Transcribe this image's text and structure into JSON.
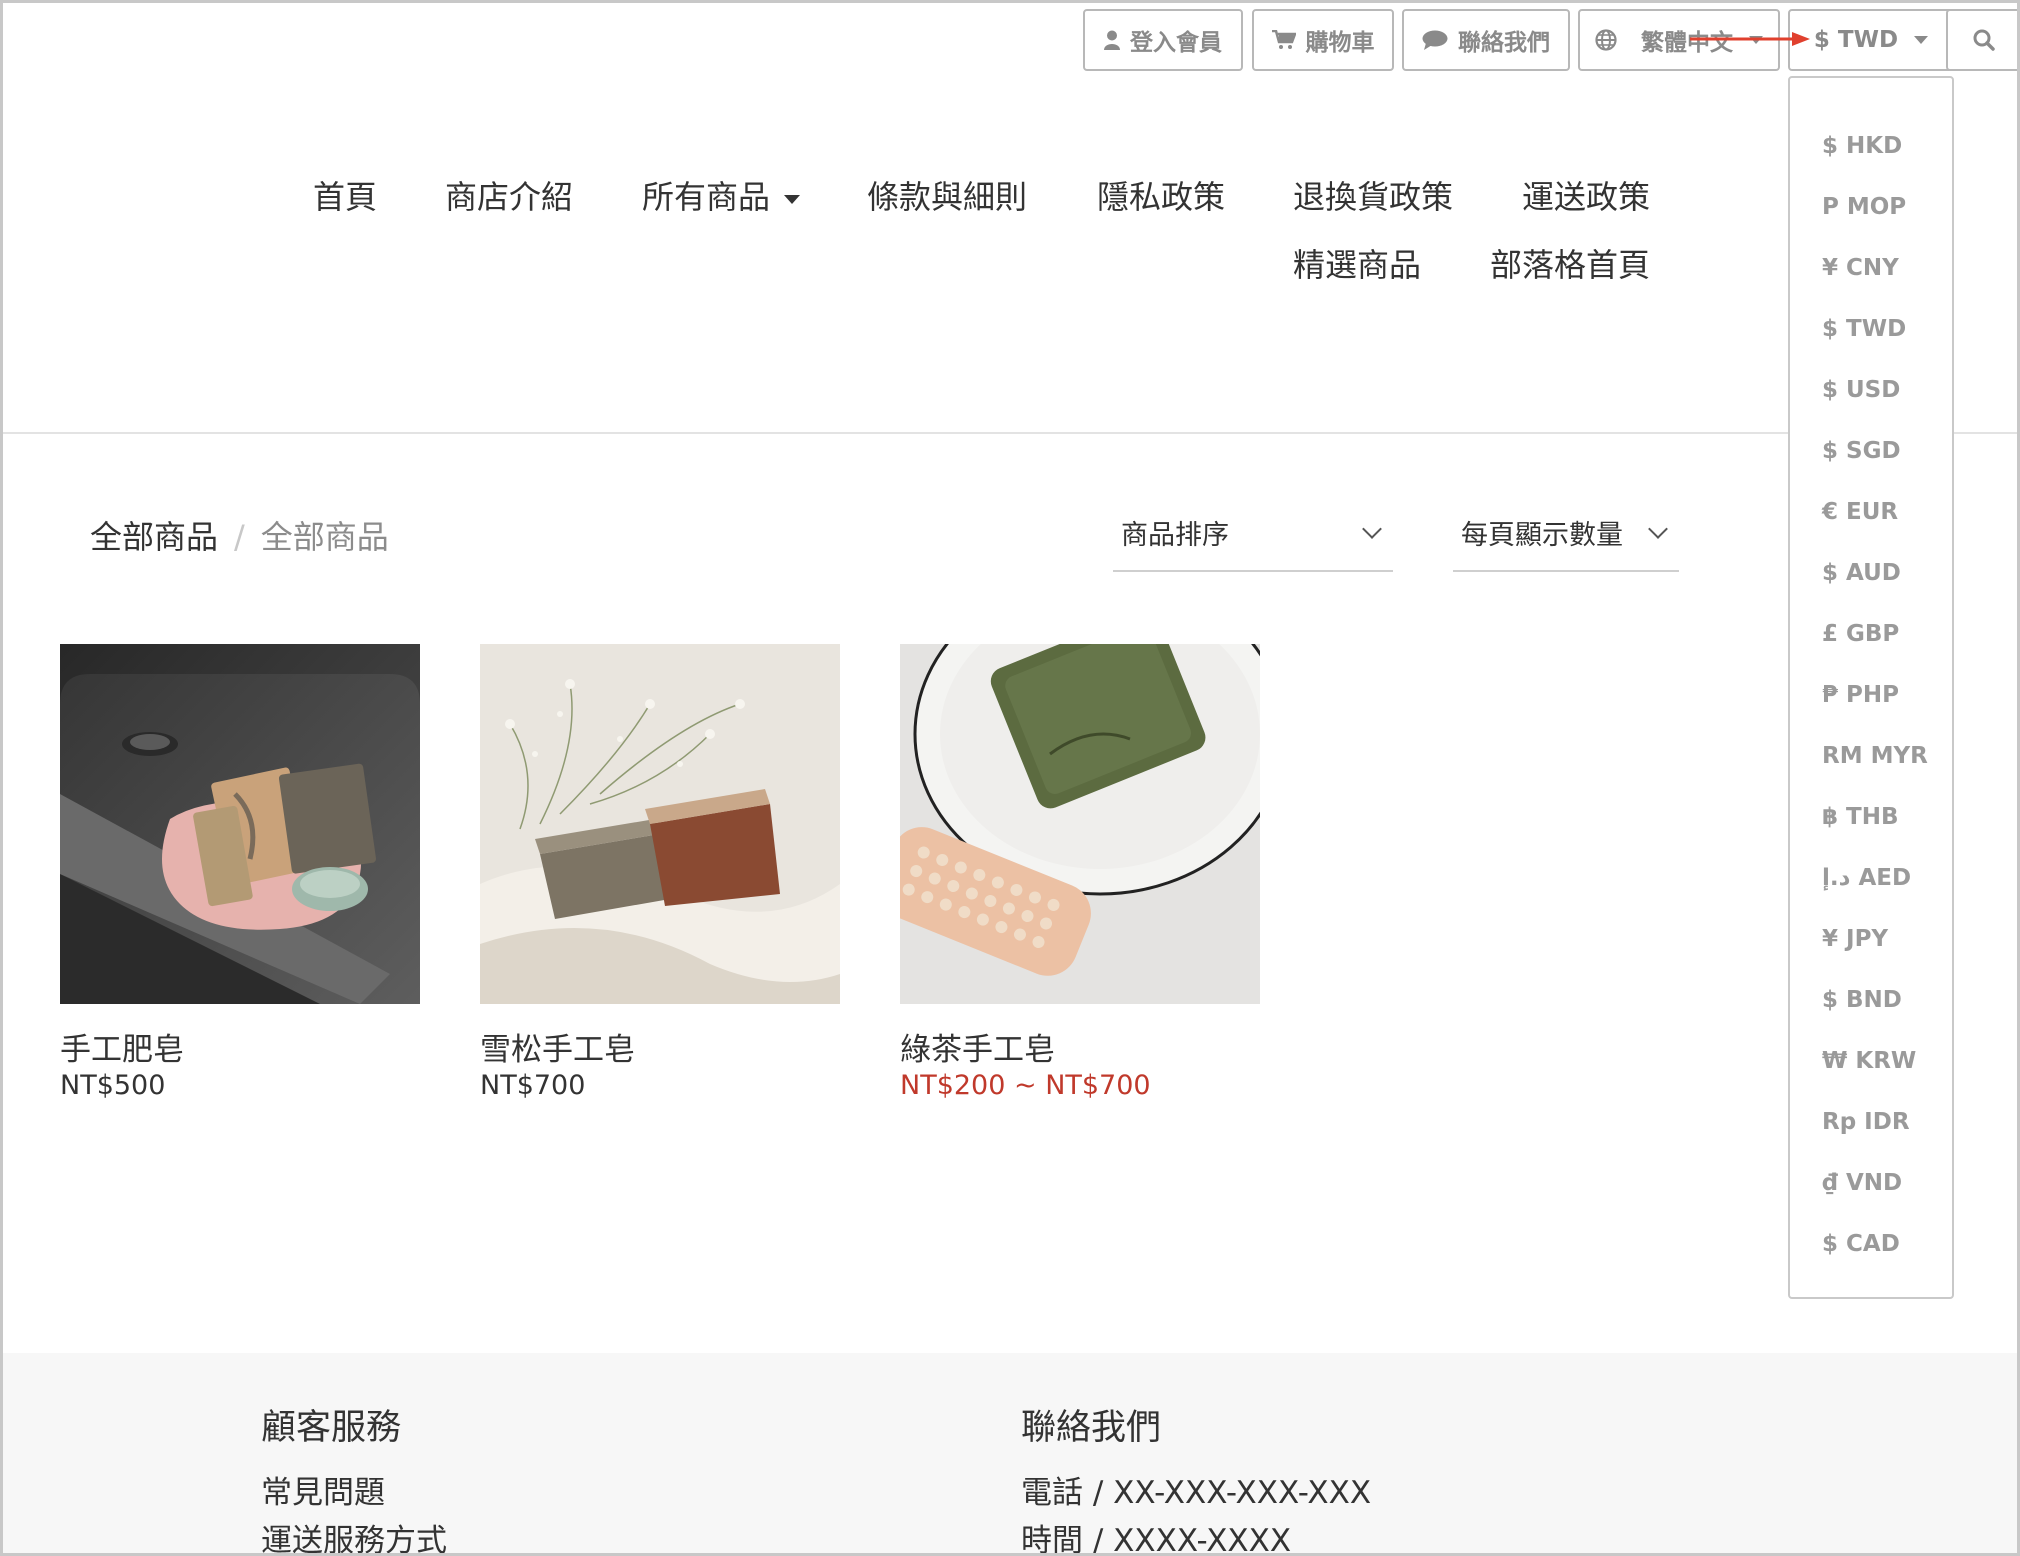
{
  "topbar": {
    "login_label": "登入會員",
    "cart_label": "購物車",
    "contact_label": "聯絡我們",
    "language_label": "繁體中文",
    "currency_label": "$ TWD"
  },
  "currency_menu": [
    "$ HKD",
    "P MOP",
    "¥ CNY",
    "$ TWD",
    "$ USD",
    "$ SGD",
    "€ EUR",
    "$ AUD",
    "£ GBP",
    "₱ PHP",
    "RM MYR",
    "฿ THB",
    "د.إ AED",
    "¥ JPY",
    "$ BND",
    "₩ KRW",
    "Rp IDR",
    "₫ VND",
    "$ CAD"
  ],
  "nav": {
    "home": "首頁",
    "about": "商店介紹",
    "all_products": "所有商品",
    "terms": "條款與細則",
    "privacy": "隱私政策",
    "returns": "退換貨政策",
    "shipping": "運送政策",
    "featured": "精選商品",
    "blog": "部落格首頁"
  },
  "breadcrumb": {
    "parent": "全部商品",
    "separator": "/",
    "current": "全部商品"
  },
  "filters": {
    "sort_label": "商品排序",
    "per_page_label": "每頁顯示數量"
  },
  "products": [
    {
      "name": "手工肥皂",
      "price": "NT$500"
    },
    {
      "name": "雪松手工皂",
      "price": "NT$700"
    },
    {
      "name": "綠茶手工皂",
      "price": "NT$200 ~ NT$700"
    }
  ],
  "footer": {
    "service_heading": "顧客服務",
    "service_links": [
      "常見問題",
      "運送服務方式"
    ],
    "contact_heading": "聯絡我們",
    "contact_lines": [
      "電話 / XX-XXX-XXX-XXX",
      "時間 / XXXX-XXXX"
    ]
  },
  "colors": {
    "price_highlight": "#c0392b",
    "annotation_arrow": "#e0402e",
    "muted_text": "#8a8a8a",
    "footer_bg": "#f7f7f7"
  },
  "icons": [
    "user-icon",
    "cart-icon",
    "chat-icon",
    "globe-icon",
    "search-icon"
  ]
}
